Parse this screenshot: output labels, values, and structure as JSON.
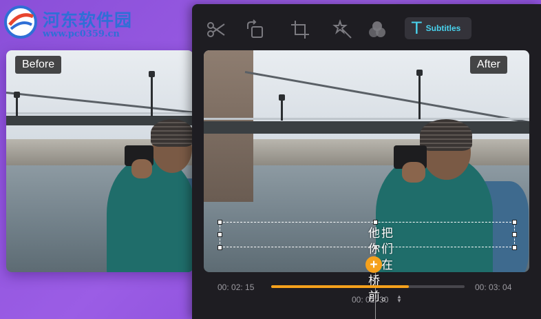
{
  "watermark": {
    "title": "河东软件园",
    "url": "www.pc0359.cn"
  },
  "before": {
    "badge": "Before"
  },
  "after": {
    "badge": "After"
  },
  "toolbar": {
    "tools": [
      "scissors-icon",
      "rotate-icon",
      "crop-icon",
      "magic-wand-icon",
      "effects-icon",
      "subtitles-icon"
    ],
    "active_label": "Subtitles",
    "active_glyph": "T",
    "active_color": "#49d3ee"
  },
  "subtitle": {
    "text": "他把你们放在桥前。"
  },
  "timeline": {
    "start": "00: 02: 15",
    "end": "00: 03: 04",
    "current": "00: 02: 30",
    "progress": 0.71,
    "accent": "#f5a11c"
  }
}
